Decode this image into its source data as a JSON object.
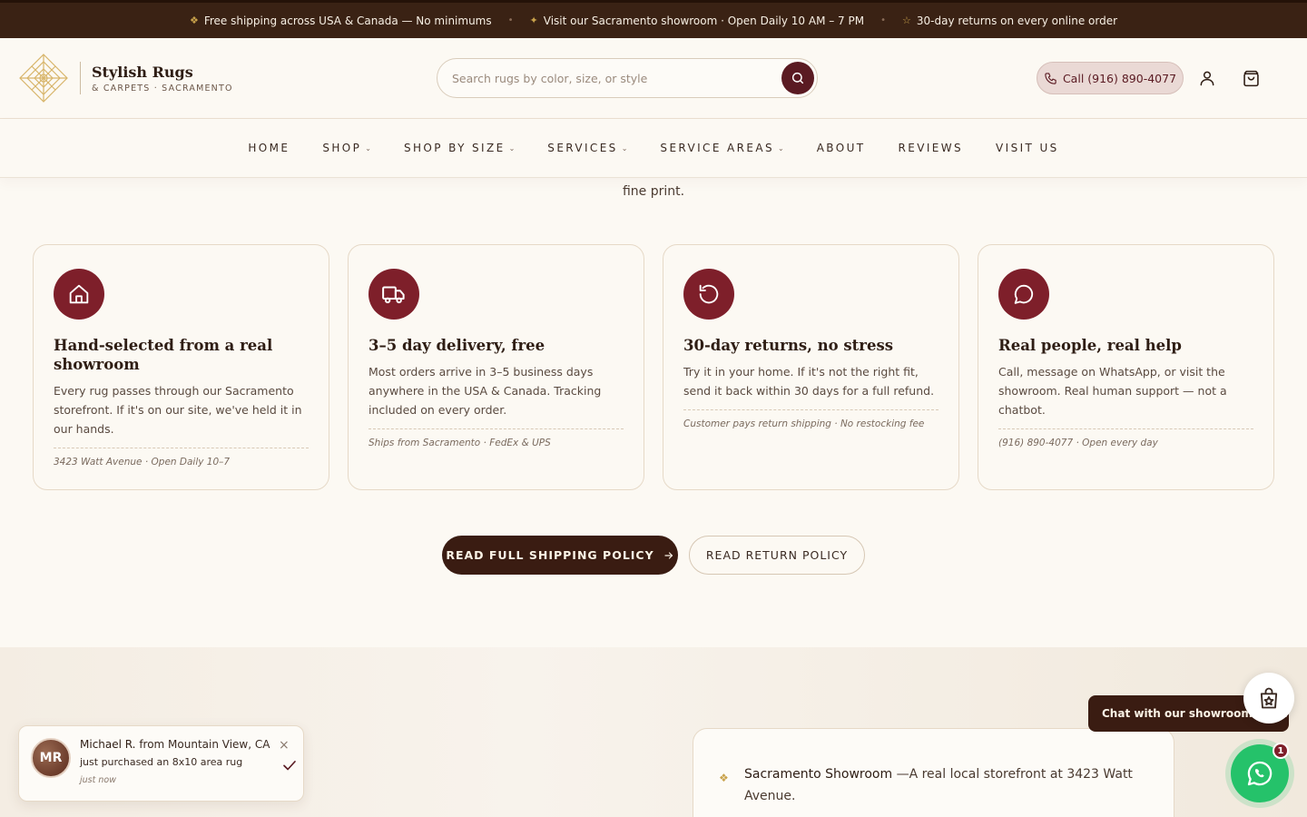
{
  "announcement": {
    "items": [
      {
        "glyph": "❖",
        "text": "Free shipping across USA & Canada — No minimums"
      },
      {
        "glyph": "✦",
        "text": "Visit our Sacramento showroom · Open Daily 10 AM – 7 PM"
      },
      {
        "glyph": "☆",
        "text": "30-day returns on every online order"
      }
    ],
    "separator": "•"
  },
  "brand": {
    "name": "Stylish Rugs",
    "tagline": "& CARPETS · SACRAMENTO"
  },
  "search": {
    "placeholder": "Search rugs by color, size, or style",
    "value": ""
  },
  "header": {
    "call_label": "Call (916) 890-4077"
  },
  "nav": {
    "items": [
      {
        "label": "HOME",
        "has_dropdown": false
      },
      {
        "label": "SHOP",
        "has_dropdown": true
      },
      {
        "label": "SHOP BY SIZE",
        "has_dropdown": true
      },
      {
        "label": "SERVICES",
        "has_dropdown": true
      },
      {
        "label": "SERVICE AREAS",
        "has_dropdown": true
      },
      {
        "label": "ABOUT",
        "has_dropdown": false
      },
      {
        "label": "REVIEWS",
        "has_dropdown": false
      },
      {
        "label": "VISIT US",
        "has_dropdown": false
      }
    ],
    "chevron": "⌄"
  },
  "intro": {
    "fine_print": "fine print."
  },
  "features": [
    {
      "icon": "home-icon",
      "title": "Hand-selected from a real showroom",
      "body": "Every rug passes through our Sacramento storefront. If it's on our site, we've held it in our hands.",
      "note": "3423 Watt Avenue · Open Daily 10–7"
    },
    {
      "icon": "truck-icon",
      "title": "3–5 day delivery, free",
      "body": "Most orders arrive in 3–5 business days anywhere in the USA & Canada. Tracking included on every order.",
      "note": "Ships from Sacramento · FedEx & UPS"
    },
    {
      "icon": "rotate-ccw-icon",
      "title": "30-day returns, no stress",
      "body": "Try it in your home. If it's not the right fit, send it back within 30 days for a full refund.",
      "note": "Customer pays return shipping · No restocking fee"
    },
    {
      "icon": "chat-bubble-icon",
      "title": "Real people, real help",
      "body": "Call, message on WhatsApp, or visit the showroom. Real human support — not a chatbot.",
      "note": "(916) 890-4077 · Open every day"
    }
  ],
  "policies": {
    "shipping_label": "READ FULL SHIPPING POLICY",
    "return_label": "READ RETURN POLICY"
  },
  "showroom": {
    "label": "Sacramento Showroom",
    "text": " —A real local storefront at 3423 Watt Avenue."
  },
  "toast": {
    "initials": "MR",
    "name": "Michael R.",
    "location": " from Mountain View, CA",
    "action": "just purchased an 8x10 area rug",
    "time": "just now",
    "close": "×"
  },
  "chat": {
    "tooltip": "Chat with our showroom team",
    "badge": "1"
  },
  "colors": {
    "topbar_bg": "#3a2214",
    "accent_burgundy": "#7e1f2a",
    "gold": "#c9a24b",
    "page_bg": "#fcf9f3",
    "whatsapp_green": "#25c26a"
  }
}
